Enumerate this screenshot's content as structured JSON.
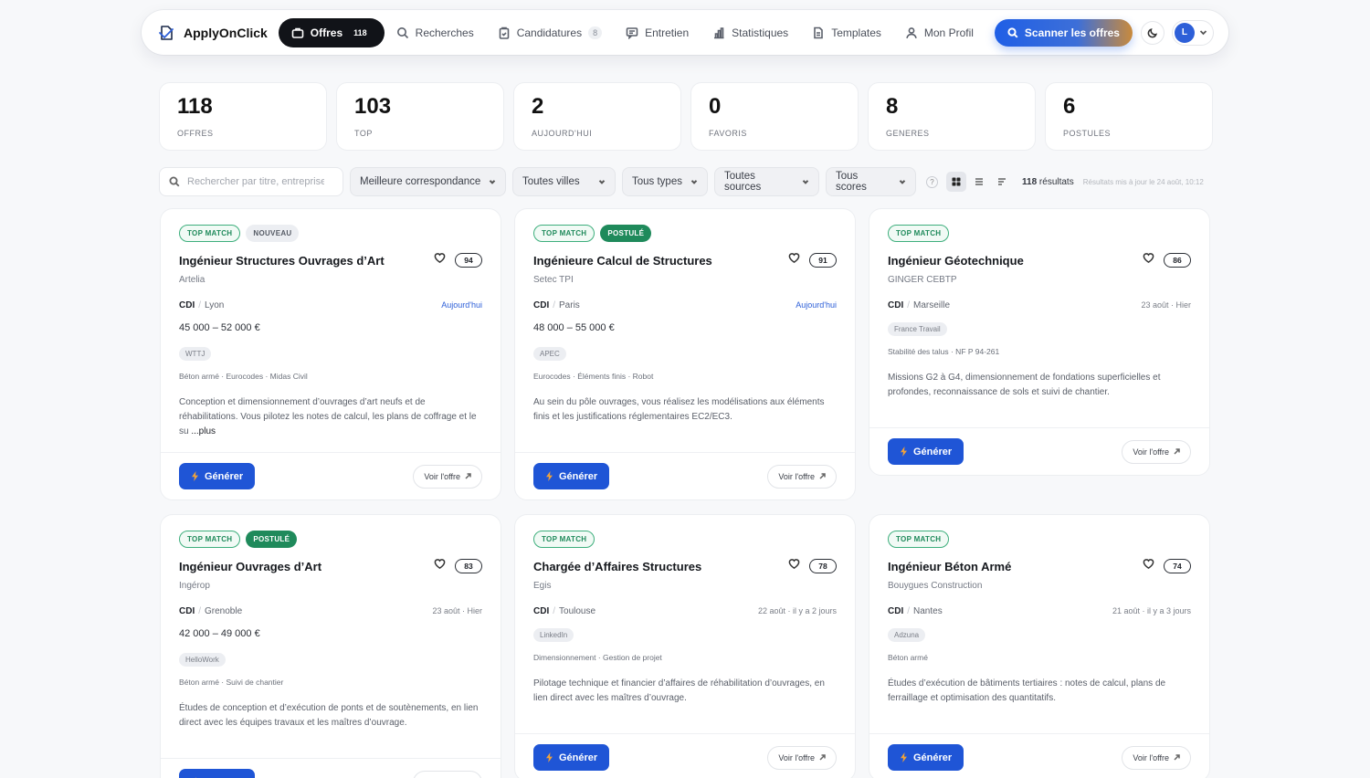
{
  "nav": {
    "brand": "ApplyOnClick",
    "items": [
      {
        "label": "Offres",
        "count": "118",
        "icon": "briefcase-icon",
        "active": true
      },
      {
        "label": "Recherches",
        "count": "",
        "icon": "search-icon"
      },
      {
        "label": "Candidatures",
        "count": "8",
        "icon": "clipboard-icon"
      },
      {
        "label": "Entretien",
        "count": "",
        "icon": "message-icon"
      },
      {
        "label": "Statistiques",
        "count": "",
        "icon": "bar-chart-icon"
      },
      {
        "label": "Templates",
        "count": "",
        "icon": "document-icon"
      },
      {
        "label": "Mon Profil",
        "count": "",
        "icon": "user-icon"
      }
    ],
    "scan_label": "Scanner les offres",
    "avatar_initial": "L"
  },
  "stats": [
    {
      "value": "118",
      "label": "OFFRES"
    },
    {
      "value": "103",
      "label": "TOP"
    },
    {
      "value": "2",
      "label": "AUJOURD'HUI"
    },
    {
      "value": "0",
      "label": "FAVORIS"
    },
    {
      "value": "8",
      "label": "GENERES"
    },
    {
      "value": "6",
      "label": "POSTULES"
    }
  ],
  "filters": {
    "search_placeholder": "Rechercher par titre, entreprise...",
    "sort": "Meilleure correspondance",
    "city": "Toutes villes",
    "type": "Tous types",
    "source": "Toutes sources",
    "score": "Tous scores",
    "help": "?",
    "results_count": "118",
    "results_word": "résultats",
    "updated": "Résultats mis à jour le 24 août, 10:12"
  },
  "card_labels": {
    "generate": "Générer",
    "view": "Voir l'offre",
    "more": "...plus"
  },
  "cards": [
    {
      "badges": [
        {
          "text": "TOP MATCH",
          "kind": "top"
        },
        {
          "text": "NOUVEAU",
          "kind": "new"
        }
      ],
      "title": "Ingénieur Structures Ouvrages d’Art",
      "score": "94",
      "company": "Artelia",
      "contract": "CDI",
      "city": "Lyon",
      "date": "Aujourd'hui",
      "today": true,
      "salary": "45 000 – 52 000 €",
      "source": "WTTJ",
      "tags": "Béton armé · Eurocodes · Midas Civil",
      "desc": "Conception et dimensionnement d’ouvrages d’art neufs et de réhabilitations. Vous pilotez les notes de calcul, les plans de coffrage et le su",
      "more": true
    },
    {
      "badges": [
        {
          "text": "TOP MATCH",
          "kind": "top"
        },
        {
          "text": "POSTULÉ",
          "kind": "applied"
        }
      ],
      "title": "Ingénieure Calcul de Structures",
      "score": "91",
      "company": "Setec TPI",
      "contract": "CDI",
      "city": "Paris",
      "date": "Aujourd'hui",
      "today": true,
      "salary": "48 000 – 55 000 €",
      "source": "APEC",
      "tags": "Eurocodes · Éléments finis · Robot",
      "desc": "Au sein du pôle ouvrages, vous réalisez les modélisations aux éléments finis et les justifications réglementaires EC2/EC3.",
      "more": false
    },
    {
      "badges": [
        {
          "text": "TOP MATCH",
          "kind": "top"
        }
      ],
      "title": "Ingénieur Géotechnique",
      "score": "86",
      "company": "GINGER CEBTP",
      "contract": "CDI",
      "city": "Marseille",
      "date": "23 août · Hier",
      "today": false,
      "salary": "",
      "source": "France Travail",
      "tags": "Stabilité des talus · NF P 94-261",
      "desc": "Missions G2 à G4, dimensionnement de fondations superficielles et profondes, reconnaissance de sols et suivi de chantier.",
      "more": false
    },
    {
      "badges": [
        {
          "text": "TOP MATCH",
          "kind": "top"
        },
        {
          "text": "POSTULÉ",
          "kind": "applied"
        }
      ],
      "title": "Ingénieur Ouvrages d’Art",
      "score": "83",
      "company": "Ingérop",
      "contract": "CDI",
      "city": "Grenoble",
      "date": "23 août · Hier",
      "today": false,
      "salary": "42 000 – 49 000 €",
      "source": "HelloWork",
      "tags": "Béton armé · Suivi de chantier",
      "desc": "Études de conception et d’exécution de ponts et de soutènements, en lien direct avec les équipes travaux et les maîtres d’ouvrage.",
      "more": false
    },
    {
      "badges": [
        {
          "text": "TOP MATCH",
          "kind": "top"
        }
      ],
      "title": "Chargée d’Affaires Structures",
      "score": "78",
      "company": "Egis",
      "contract": "CDI",
      "city": "Toulouse",
      "date": "22 août · il y a 2 jours",
      "today": false,
      "salary": "",
      "source": "LinkedIn",
      "tags": "Dimensionnement · Gestion de projet",
      "desc": "Pilotage technique et financier d’affaires de réhabilitation d’ouvrages, en lien direct avec les maîtres d’ouvrage.",
      "more": false
    },
    {
      "badges": [
        {
          "text": "TOP MATCH",
          "kind": "top"
        }
      ],
      "title": "Ingénieur Béton Armé",
      "score": "74",
      "company": "Bouygues Construction",
      "contract": "CDI",
      "city": "Nantes",
      "date": "21 août · il y a 3 jours",
      "today": false,
      "salary": "",
      "source": "Adzuna",
      "tags": "Béton armé",
      "desc": "Études d’exécution de bâtiments tertiaires : notes de calcul, plans de ferraillage et optimisation des quantitatifs.",
      "more": false
    }
  ]
}
